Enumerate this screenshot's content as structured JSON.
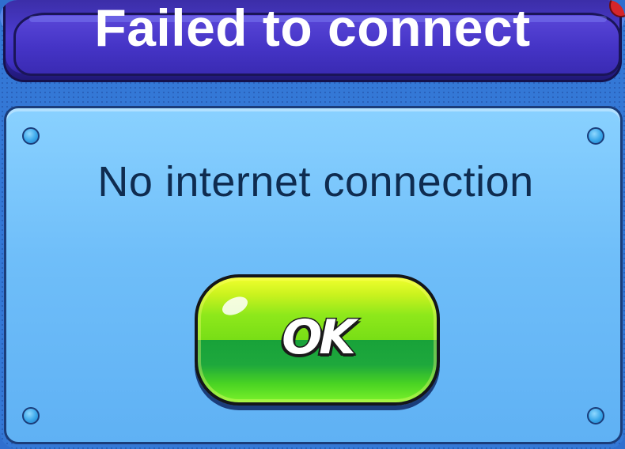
{
  "dialog": {
    "title": "Failed to connect",
    "message": "No internet connection",
    "ok_label": "OK"
  },
  "colors": {
    "header": "#4534c6",
    "panel": "#6fbef9",
    "ok_button": "#78de16",
    "message_text": "#0f2c50"
  },
  "icons": [
    "rivet-icon",
    "corner-badge-icon"
  ]
}
